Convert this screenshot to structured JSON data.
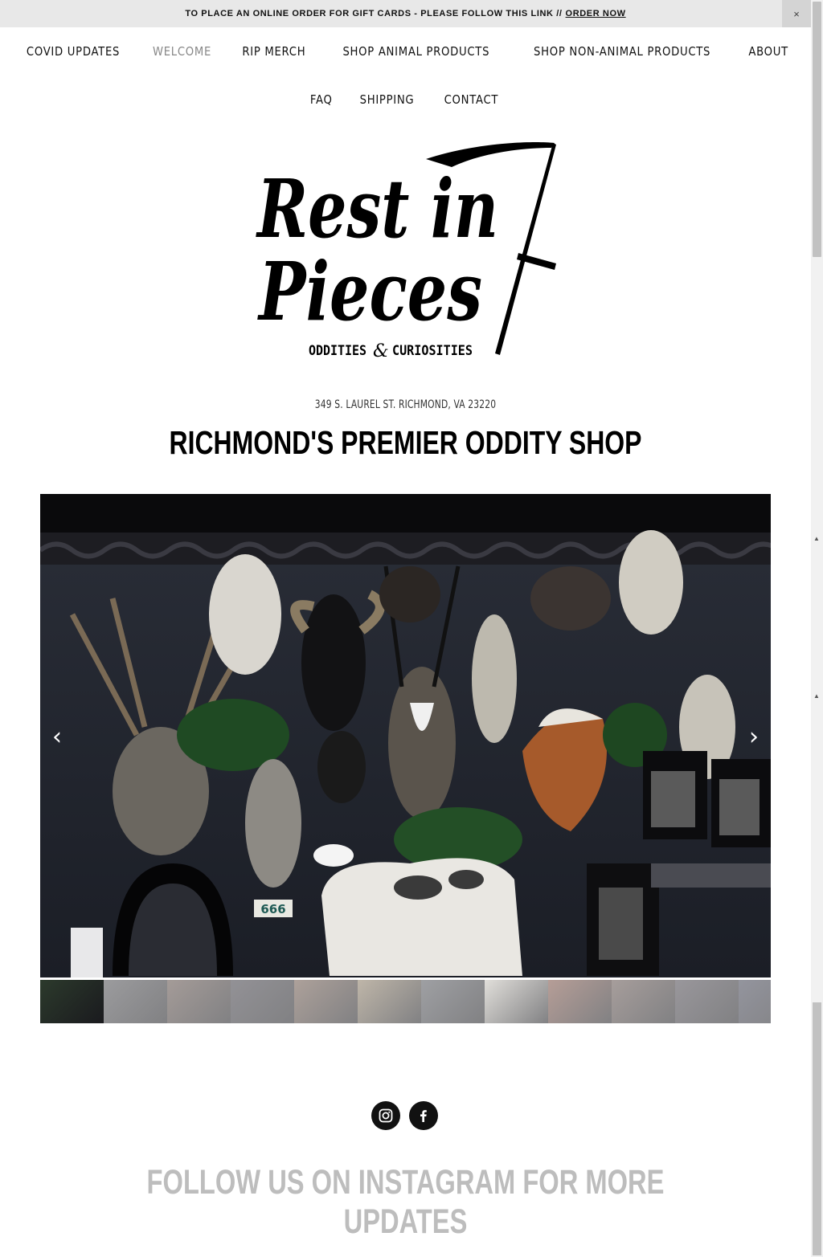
{
  "announcement": {
    "text": "TO PLACE AN ONLINE ORDER FOR GIFT CARDS - PLEASE FOLLOW THIS LINK //",
    "link_label": "ORDER NOW",
    "close_label": "×"
  },
  "nav": {
    "row1": [
      {
        "label": "COVID UPDATES",
        "active": false
      },
      {
        "label": "WELCOME",
        "active": true
      },
      {
        "label": "RIP MERCH",
        "active": false
      },
      {
        "label": "SHOP ANIMAL PRODUCTS",
        "active": false
      },
      {
        "label": "SHOP NON-ANIMAL PRODUCTS",
        "active": false
      },
      {
        "label": "ABOUT",
        "active": false
      }
    ],
    "row2": [
      {
        "label": "FAQ",
        "active": false
      },
      {
        "label": "SHIPPING",
        "active": false
      },
      {
        "label": "CONTACT",
        "active": false
      }
    ]
  },
  "logo": {
    "line1": "Rest in",
    "line2": "Pieces",
    "tagline": "ODDITIES",
    "tagline_amp": "&",
    "tagline2": "CURIOSITIES"
  },
  "address": "349 S. LAUREL ST. RICHMOND, VA 23220",
  "headline": "RICHMOND'S PREMIER ODDITY SHOP",
  "gallery": {
    "prev_label": "‹",
    "next_label": "›",
    "plaque_number": "666",
    "thumbnail_count": 12,
    "active_index": 0
  },
  "socials": [
    {
      "name": "instagram-icon"
    },
    {
      "name": "facebook-icon"
    }
  ],
  "follow_text": "FOLLOW US ON INSTAGRAM FOR MORE UPDATES",
  "colors": {
    "announcement_bg": "#e8e8e8",
    "active_nav": "#888888",
    "follow_text": "#bdbdbd"
  }
}
